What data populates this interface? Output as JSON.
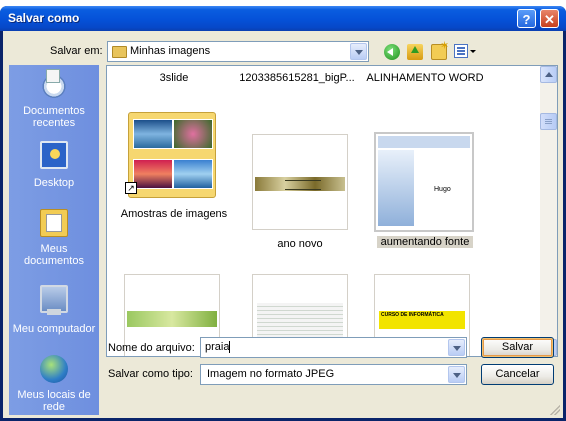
{
  "window": {
    "title": "Salvar como",
    "help_label": "?",
    "close_label": "✕"
  },
  "save_in": {
    "label": "Salvar em:",
    "value": "Minhas imagens"
  },
  "places": [
    {
      "label": "Documentos recentes",
      "icon": "recent-documents-icon"
    },
    {
      "label": "Desktop",
      "icon": "desktop-icon"
    },
    {
      "label": "Meus documentos",
      "icon": "my-documents-icon"
    },
    {
      "label": "Meu computador",
      "icon": "my-computer-icon"
    },
    {
      "label": "Meus locais de rede",
      "icon": "network-places-icon"
    }
  ],
  "files": {
    "top_row": [
      "3slide",
      "1203385615281_bigP...",
      "ALINHAMENTO WORD"
    ],
    "items": [
      {
        "label": "Amostras de imagens",
        "type": "folder-shortcut"
      },
      {
        "label": "ano novo",
        "type": "image"
      },
      {
        "label": "aumentando fonte",
        "type": "image",
        "selected": true
      },
      {
        "label": "",
        "type": "image"
      },
      {
        "label": "",
        "type": "image"
      },
      {
        "label": "",
        "type": "image"
      }
    ],
    "thumb_texts": {
      "word_doc": "Hugo",
      "course": "CURSO DE INFORMÁTICA"
    }
  },
  "filename": {
    "label": "Nome do arquivo:",
    "value": "praia"
  },
  "filetype": {
    "label": "Salvar como tipo:",
    "value": "Imagem no formato JPEG"
  },
  "buttons": {
    "save": "Salvar",
    "cancel": "Cancelar"
  },
  "colors": {
    "titlebar": "#0551d8",
    "places_bar": "#7d9de4",
    "dialog_bg": "#ece9d8"
  }
}
